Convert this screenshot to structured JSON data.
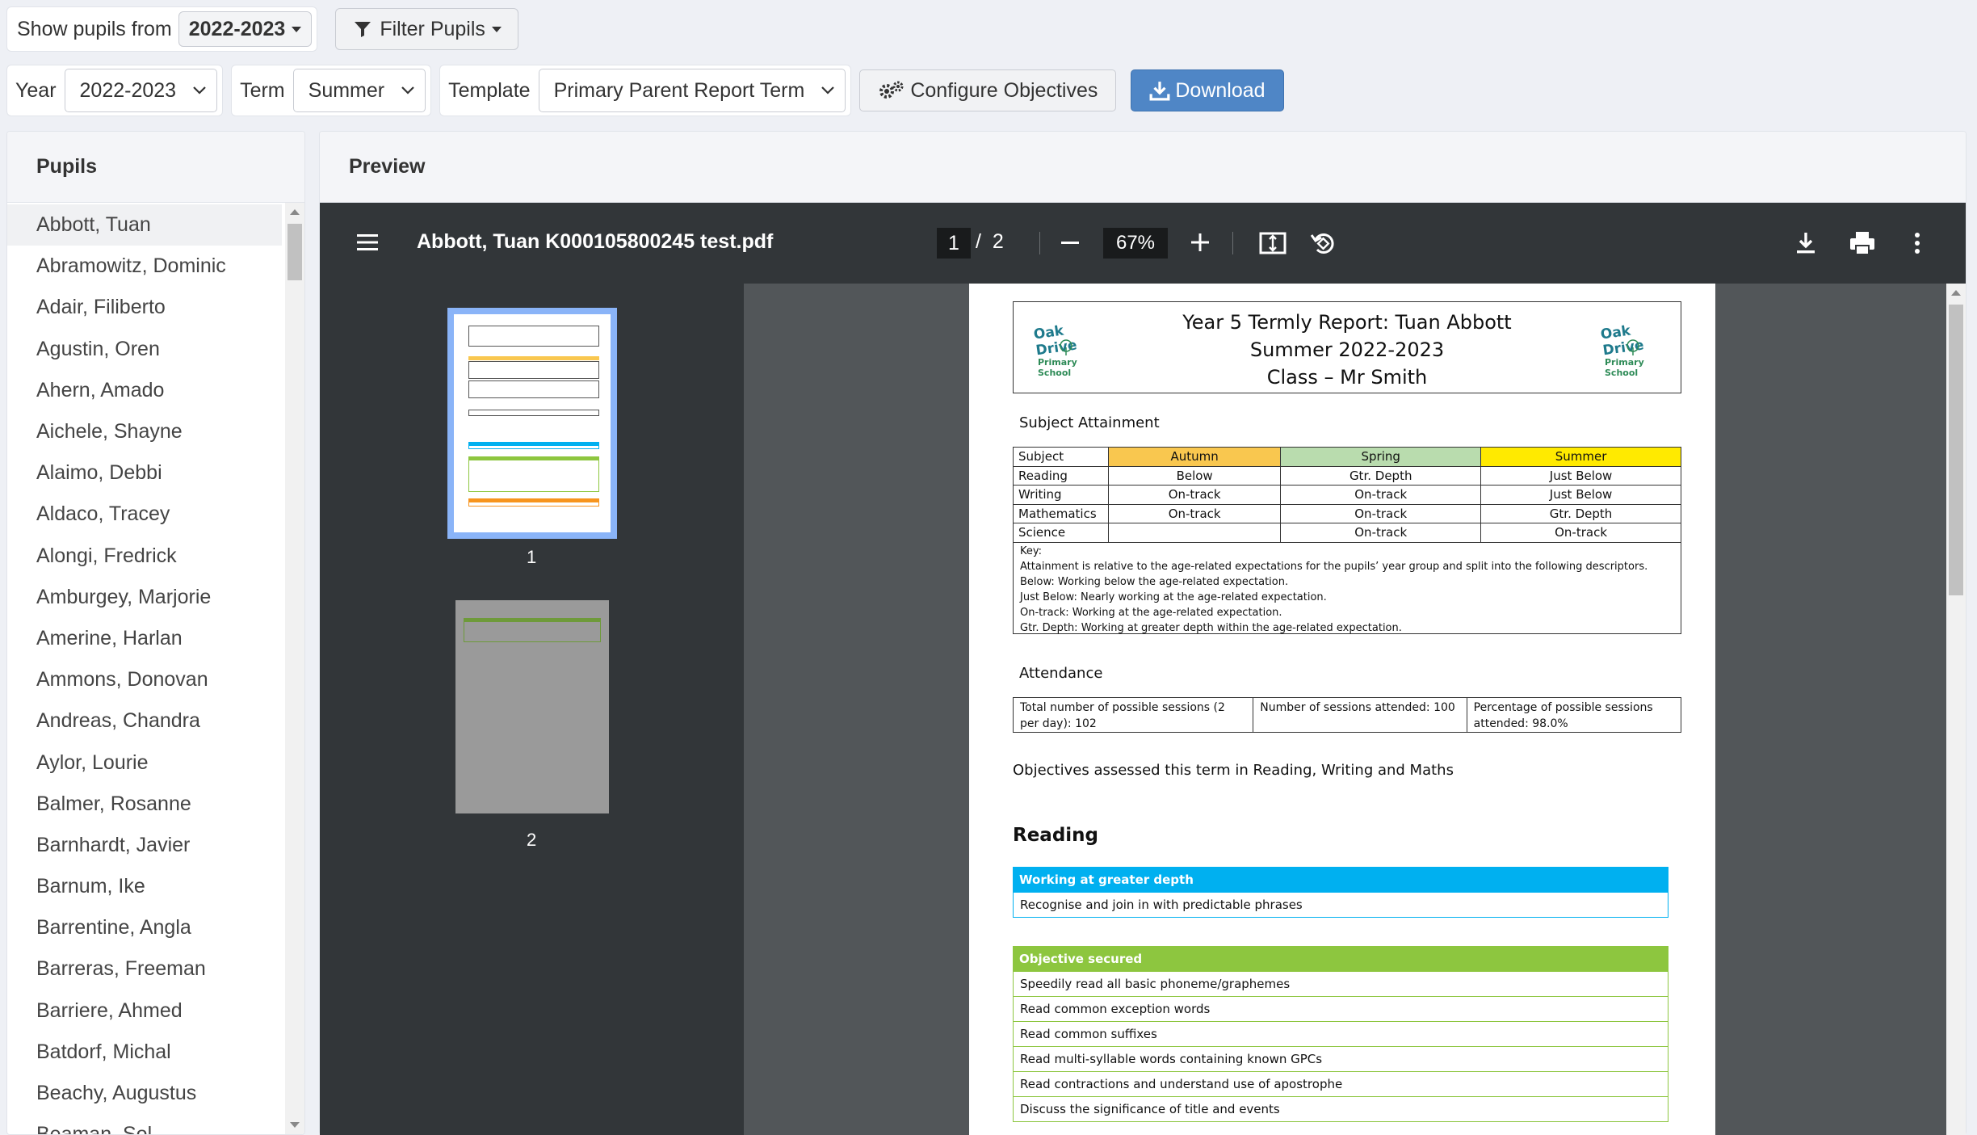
{
  "filters": {
    "show_pupils_label": "Show pupils from",
    "show_pupils_value": "2022-2023",
    "filter_button": "Filter Pupils",
    "year_label": "Year",
    "year_value": "2022-2023",
    "term_label": "Term",
    "term_value": "Summer",
    "template_label": "Template",
    "template_value": "Primary Parent Report Term",
    "configure_button": "Configure Objectives",
    "download_button": "Download"
  },
  "pupils": {
    "title": "Pupils",
    "items": [
      "Abbott, Tuan",
      "Abramowitz, Dominic",
      "Adair, Filiberto",
      "Agustin, Oren",
      "Ahern, Amado",
      "Aichele, Shayne",
      "Alaimo, Debbi",
      "Aldaco, Tracey",
      "Alongi, Fredrick",
      "Amburgey, Marjorie",
      "Amerine, Harlan",
      "Ammons, Donovan",
      "Andreas, Chandra",
      "Aylor, Lourie",
      "Balmer, Rosanne",
      "Barnhardt, Javier",
      "Barnum, Ike",
      "Barrentine, Angla",
      "Barreras, Freeman",
      "Barriere, Ahmed",
      "Batdorf, Michal",
      "Beachy, Augustus",
      "Beaman, Sol"
    ],
    "selected_index": 0
  },
  "preview": {
    "title": "Preview",
    "viewer": {
      "filename": "Abbott, Tuan K000105800245 test.pdf",
      "current_page": "1",
      "page_sep": "/",
      "total_pages": "2",
      "zoom": "67%",
      "thumb_labels": [
        "1",
        "2"
      ]
    },
    "report": {
      "title_line1": "Year 5 Termly Report: Tuan  Abbott",
      "title_line2": "Summer 2022-2023",
      "title_line3": "Class – Mr Smith",
      "logo_name": "Oak Drive",
      "logo_sub": "Primary School",
      "attainment_label": "Subject Attainment",
      "attainment_headers": [
        "Subject",
        "Autumn",
        "Spring",
        "Summer"
      ],
      "attainment_rows": [
        [
          "Reading",
          "Below",
          "Gtr. Depth",
          "Just Below"
        ],
        [
          "Writing",
          "On-track",
          "On-track",
          "Just Below"
        ],
        [
          "Mathematics",
          "On-track",
          "On-track",
          "Gtr. Depth"
        ],
        [
          "Science",
          "",
          "On-track",
          "On-track"
        ]
      ],
      "key_lines": [
        "Key:",
        "Attainment is relative to the age-related expectations for the pupils’ year group and split into the following descriptors.",
        "Below: Working below the age-related expectation.",
        "Just Below: Nearly working at the age-related expectation.",
        "On-track: Working at the age-related expectation.",
        "Gtr. Depth: Working at greater depth within the age-related expectation."
      ],
      "attendance_label": "Attendance",
      "attendance_cells": [
        "Total number of possible sessions (2 per day): 102",
        "Number of sessions attended: 100",
        "Percentage of possible sessions attended: 98.0%"
      ],
      "objectives_intro": "Objectives assessed this term in Reading, Writing and Maths",
      "reading_heading": "Reading",
      "greater_depth_heading": "Working at greater depth",
      "greater_depth_items": [
        "Recognise and join in with predictable phrases"
      ],
      "secured_heading": "Objective secured",
      "secured_items": [
        "Speedily read all basic phoneme/graphemes",
        "Read common exception words",
        "Read common suffixes",
        "Read multi-syllable words containing known GPCs",
        "Read contractions and understand use of apostrophe",
        "Discuss the significance of title and events"
      ]
    }
  },
  "colors": {
    "autumn": "#f9c74f",
    "spring": "#b9dcae",
    "summer": "#ffea00",
    "greater_depth": "#00b0f0",
    "secured": "#8dc63f",
    "download_btn": "#4f86c6"
  },
  "icons": [
    "filter-icon",
    "cogs-icon",
    "download-icon",
    "menu-icon",
    "fit-page-icon",
    "rotate-icon",
    "viewer-download-icon",
    "print-icon",
    "more-icon"
  ]
}
